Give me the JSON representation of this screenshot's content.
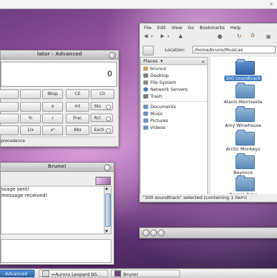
{
  "top_strip": {
    "close": "x"
  },
  "calculator": {
    "title": "lator - Advanced",
    "display_value": "0",
    "rows": [
      [
        "",
        "",
        "Bksp",
        "CE",
        "Clr"
      ],
      [
        "",
        "",
        "±",
        "Int",
        "Sto"
      ],
      [
        "",
        "%",
        "√",
        "Frac",
        "Rcl"
      ],
      [
        "",
        "1/x",
        "x²",
        "Abs",
        "Exch"
      ]
    ],
    "status": "precedence"
  },
  "file_manager": {
    "menu": [
      "File",
      "Edit",
      "View",
      "Go",
      "Bookmarks",
      "Help"
    ],
    "location_label": "Location:",
    "location_value": "/home/bruno/Musicas",
    "places_header": "Places",
    "places": [
      {
        "label": "bruno2",
        "icon": "home-icon",
        "color": "#c9a46a"
      },
      {
        "label": "Desktop",
        "icon": "desktop-icon",
        "color": "#7d7d7d"
      },
      {
        "label": "File System",
        "icon": "drive-icon",
        "color": "#8a8a8a"
      },
      {
        "label": "Network Servers",
        "icon": "network-icon",
        "color": "#4a74b0"
      },
      {
        "label": "Trash",
        "icon": "trash-icon",
        "color": "#7a7a7a"
      },
      {
        "label": "Documents",
        "icon": "folder-icon",
        "color": "#6d93c0"
      },
      {
        "label": "Music",
        "icon": "folder-icon",
        "color": "#6d93c0"
      },
      {
        "label": "Pictures",
        "icon": "folder-icon",
        "color": "#6d93c0"
      },
      {
        "label": "Videos",
        "icon": "folder-icon",
        "color": "#6d93c0"
      }
    ],
    "folders": [
      "300 soundtrack",
      "Alanis Morrissete",
      "Amy Winehouse",
      "Arctic Monkeys",
      "Beyonce",
      "Bonnie Tyler"
    ],
    "status": "\"300 soundtrack\" selected (containing 1 item)"
  },
  "chat": {
    "title": "Bruno!",
    "messages": [
      "ssage sent!",
      "message received!"
    ]
  },
  "taskbar": {
    "items": [
      {
        "label": "- Advanced",
        "active": true
      },
      {
        "label": "≈Aurora Leopard BS...",
        "active": false
      },
      {
        "label": "Bruno!",
        "active": false
      }
    ]
  },
  "colors": {
    "accent": "#3d7ec7",
    "folder": "#6d93c0"
  }
}
